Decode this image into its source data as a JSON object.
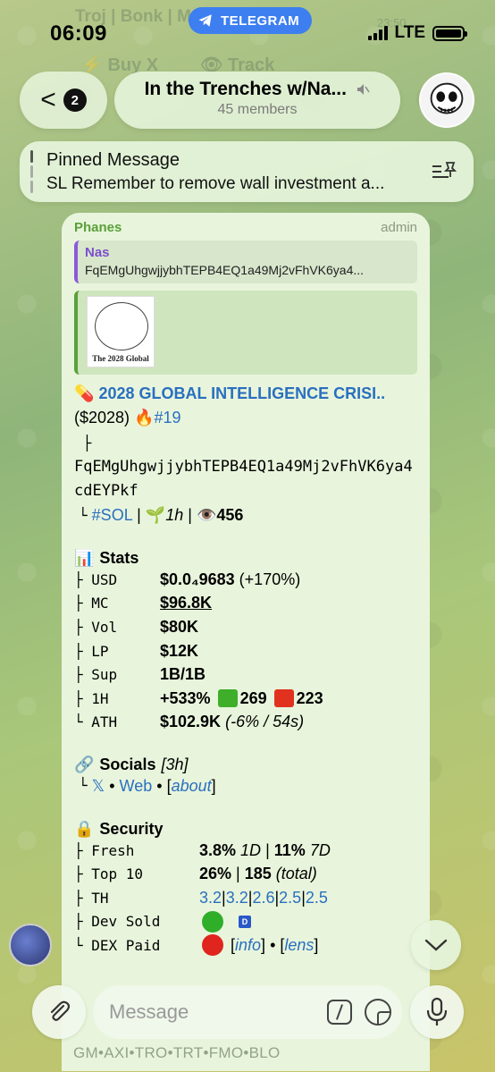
{
  "status_bar": {
    "time": "06:09",
    "app_pill": "TELEGRAM",
    "network": "LTE"
  },
  "ghost_keyboard": {
    "row1": "Troj | Bonk | M",
    "row1_time": "23:50",
    "buy_label": "Buy X",
    "track_label": "Track"
  },
  "header": {
    "back_badge": "2",
    "title": "In the Trenches w/Na...",
    "members": "45 members"
  },
  "pinned": {
    "title": "Pinned Message",
    "text": "SL Remember to remove wall investment a..."
  },
  "message": {
    "sender": "Phanes",
    "role": "admin",
    "reply": {
      "name": "Nas",
      "text": "FqEMgUhgwjjybhTEPB4EQ1a49Mj2vFhVK6ya4..."
    },
    "preview_caption": "The 2028 Global",
    "token": {
      "pill": "💊",
      "name": "2028 GLOBAL INTELLIGENCE CRISI..",
      "ticker": "($2028)",
      "rank": "🔥#19",
      "branch1": "├",
      "ca": "FqEMgUhgwjjybhTEPB4EQ1a49Mj2vFhVK6ya4cdEYPkf",
      "branch2": "└",
      "chain": "#SOL",
      "sep": "|",
      "age_icon": "🌱",
      "age": "1h",
      "views_icon": "👁️",
      "views": "456"
    },
    "stats": {
      "icon": "📊",
      "title": "Stats",
      "rows": [
        {
          "k": "├ USD",
          "v": "$0.0₄9683",
          "extra": "(+170%)"
        },
        {
          "k": "├ MC",
          "v": "$96.8K"
        },
        {
          "k": "├ Vol",
          "v": "$80K"
        },
        {
          "k": "├ LP",
          "v": "$12K"
        },
        {
          "k": "├ Sup",
          "v": "1B/1B"
        },
        {
          "k": "├ 1H",
          "v": "+533%",
          "buys": "269",
          "sells": "223"
        },
        {
          "k": "└ ATH",
          "v": "$102.9K",
          "extra": "(-6% / 54s)"
        }
      ]
    },
    "socials": {
      "icon": "🔗",
      "title": "Socials",
      "age": "[3h]",
      "branch": "└",
      "x": "𝕏",
      "dot1": "•",
      "web": "Web",
      "dot2": "•",
      "about_open": "[",
      "about": "about",
      "about_close": "]"
    },
    "security": {
      "icon": "🔒",
      "title": "Security",
      "fresh_k": "├ Fresh",
      "fresh_1d": "3.8%",
      "fresh_1d_label": "1D",
      "fresh_7d": "11%",
      "fresh_7d_label": "7D",
      "top10_k": "├ Top 10",
      "top10_v": "26%",
      "top10_total": "185",
      "top10_total_label": "(total)",
      "th_k": "├ TH",
      "th_values": [
        "3.2",
        "3.2",
        "2.6",
        "2.5",
        "2.5"
      ],
      "devsold_k": "├ Dev Sold",
      "dev_badge": "D",
      "dexpaid_k": "└ DEX Paid",
      "info": "info",
      "lens": "lens",
      "bullet": "•"
    },
    "bottom_links": "GM•AXI•TRO•TRT•FMO•BLO"
  },
  "input": {
    "placeholder": "Message"
  },
  "colors": {
    "bubble": "#e8f5dc",
    "link": "#2a6fc0",
    "sender": "#5aa03a",
    "reply_accent": "#8a5ad8",
    "green_square": "#3fae2a",
    "red_square": "#e0321e",
    "green_dot": "#2fae2a",
    "red_dot": "#e0241e"
  }
}
